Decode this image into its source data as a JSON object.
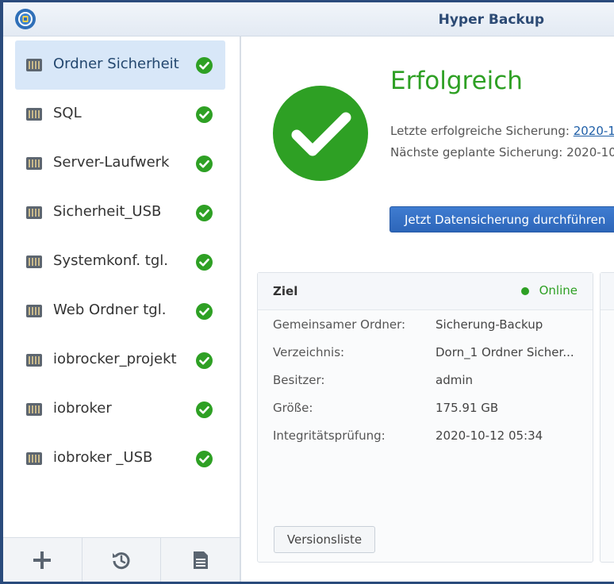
{
  "window": {
    "title": "Hyper Backup"
  },
  "sidebar": {
    "tasks": [
      {
        "label": "Ordner Sicherheit",
        "status": "success"
      },
      {
        "label": "SQL",
        "status": "success"
      },
      {
        "label": "Server-Laufwerk",
        "status": "success"
      },
      {
        "label": "Sicherheit_USB",
        "status": "success"
      },
      {
        "label": "Systemkonf. tgl.",
        "status": "success"
      },
      {
        "label": "Web Ordner tgl.",
        "status": "success"
      },
      {
        "label": "iobrocker_projekt",
        "status": "success"
      },
      {
        "label": "iobroker",
        "status": "success"
      },
      {
        "label": "iobroker _USB",
        "status": "success"
      }
    ],
    "selected_index": 0,
    "footer": [
      {
        "icon": "plus-icon"
      },
      {
        "icon": "restore-icon"
      },
      {
        "icon": "log-icon"
      }
    ]
  },
  "main": {
    "status_title": "Erfolgreich",
    "last_backup_label": "Letzte erfolgreiche Sicherung:",
    "last_backup_value": "2020-1",
    "next_backup_label": "Nächste geplante Sicherung:",
    "next_backup_value": "2020-10",
    "backup_now_button": "Jetzt Datensicherung durchführen",
    "target_card": {
      "title": "Ziel",
      "status": "Online",
      "rows": [
        {
          "key": "Gemeinsamer Ordner:",
          "value": "Sicherung-Backup"
        },
        {
          "key": "Verzeichnis:",
          "value": "Dorn_1 Ordner Sicher..."
        },
        {
          "key": "Besitzer:",
          "value": "admin"
        },
        {
          "key": "Größe:",
          "value": "175.91 GB"
        },
        {
          "key": "Integritätsprüfung:",
          "value": "2020-10-12 05:34"
        }
      ],
      "version_list_button": "Versionsliste"
    }
  },
  "colors": {
    "accent": "#2d66b9",
    "success": "#2ea024",
    "selected_bg": "#d8e7f8",
    "title_text": "#2c4a74"
  }
}
